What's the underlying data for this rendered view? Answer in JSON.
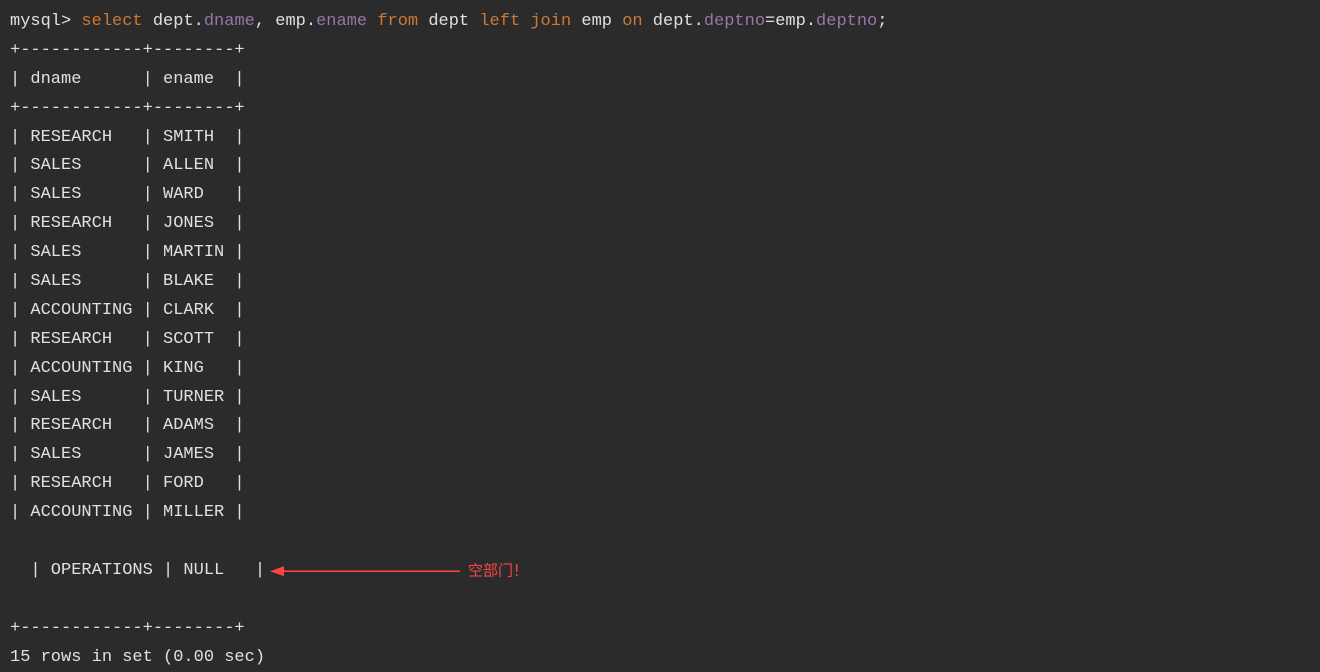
{
  "prompt": "mysql>",
  "query": {
    "select": "select",
    "field1_table": "dept",
    "field1_col": "dname",
    "comma": ",",
    "field2_table": "emp",
    "field2_col": "ename",
    "from": "from",
    "table1": "dept",
    "left": "left",
    "join": "join",
    "table2": "emp",
    "on": "on",
    "cond1_table": "dept",
    "cond1_col": "deptno",
    "eq": "=",
    "cond2_table": "emp",
    "cond2_col": "deptno",
    "semi": ";"
  },
  "table": {
    "border_top": "+------------+--------+",
    "header": "| dname      | ename  |",
    "border_mid": "+------------+--------+",
    "rows": [
      "| RESEARCH   | SMITH  |",
      "| SALES      | ALLEN  |",
      "| SALES      | WARD   |",
      "| RESEARCH   | JONES  |",
      "| SALES      | MARTIN |",
      "| SALES      | BLAKE  |",
      "| ACCOUNTING | CLARK  |",
      "| RESEARCH   | SCOTT  |",
      "| ACCOUNTING | KING   |",
      "| SALES      | TURNER |",
      "| RESEARCH   | ADAMS  |",
      "| SALES      | JAMES  |",
      "| RESEARCH   | FORD   |",
      "| ACCOUNTING | MILLER |",
      "| OPERATIONS | NULL   |"
    ],
    "border_bot": "+------------+--------+"
  },
  "result_summary": "15 rows in set (0.00 sec)",
  "annotation": {
    "text": "空部门！"
  }
}
